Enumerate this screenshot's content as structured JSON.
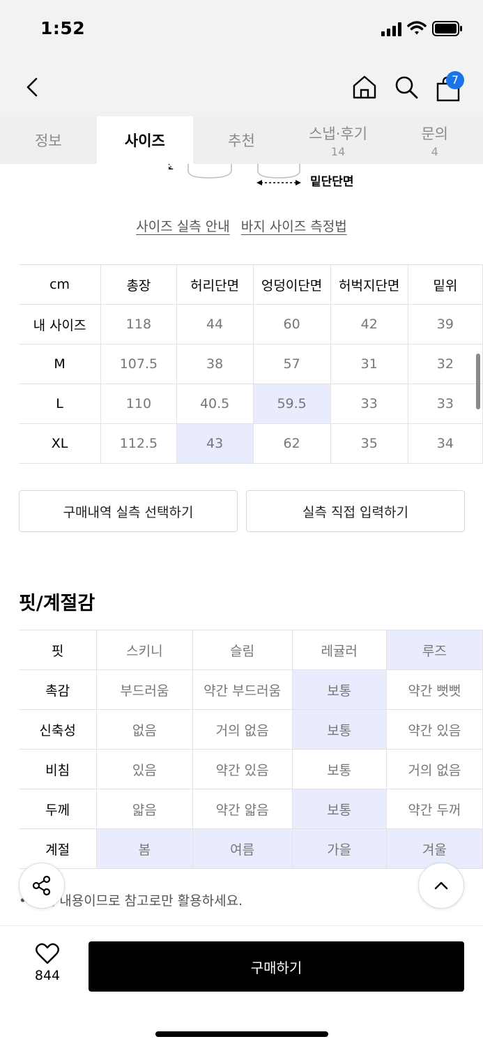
{
  "status": {
    "time": "1:52"
  },
  "header": {
    "cart_count": "7"
  },
  "tabs": [
    {
      "label": "정보",
      "count": ""
    },
    {
      "label": "사이즈",
      "count": ""
    },
    {
      "label": "추천",
      "count": ""
    },
    {
      "label": "스냅·후기",
      "count": "14"
    },
    {
      "label": "문의",
      "count": "4"
    }
  ],
  "diagram": {
    "label": "밑단단면"
  },
  "links": {
    "size_guide": "사이즈 실측 안내",
    "pants_measure": "바지 사이즈 측정법"
  },
  "size_table": {
    "headers": [
      "cm",
      "총장",
      "허리단면",
      "엉덩이단면",
      "허벅지단면",
      "밑위"
    ],
    "rows": [
      {
        "label": "내 사이즈",
        "values": [
          "118",
          "44",
          "60",
          "42",
          "39"
        ]
      },
      {
        "label": "M",
        "values": [
          "107.5",
          "38",
          "57",
          "31",
          "32"
        ]
      },
      {
        "label": "L",
        "values": [
          "110",
          "40.5",
          "59.5",
          "33",
          "33"
        ]
      },
      {
        "label": "XL",
        "values": [
          "112.5",
          "43",
          "62",
          "35",
          "34"
        ]
      }
    ]
  },
  "buttons": {
    "purchase_history": "구매내역 실측 선택하기",
    "manual_input": "실측 직접 입력하기"
  },
  "fit_section": {
    "title": "핏/계절감",
    "rows": [
      {
        "label": "핏",
        "values": [
          "스키니",
          "슬림",
          "레귤러",
          "루즈"
        ]
      },
      {
        "label": "촉감",
        "values": [
          "부드러움",
          "약간 부드러움",
          "보통",
          "약간 뻣뻣"
        ]
      },
      {
        "label": "신축성",
        "values": [
          "없음",
          "거의 없음",
          "보통",
          "약간 있음"
        ]
      },
      {
        "label": "비침",
        "values": [
          "있음",
          "약간 있음",
          "보통",
          "거의 없음"
        ]
      },
      {
        "label": "두께",
        "values": [
          "얇음",
          "약간 얇음",
          "보통",
          "약간 두꺼"
        ]
      },
      {
        "label": "계절",
        "values": [
          "봄",
          "여름",
          "가을",
          "겨울"
        ]
      }
    ],
    "note": "• 적인 내용이므로 참고로만 활용하세요."
  },
  "bottom": {
    "likes": "844",
    "buy_label": "구매하기"
  },
  "colors": {
    "highlight": "#e8ecfc",
    "badge": "#1a73e8",
    "buy_button": "#000000"
  }
}
